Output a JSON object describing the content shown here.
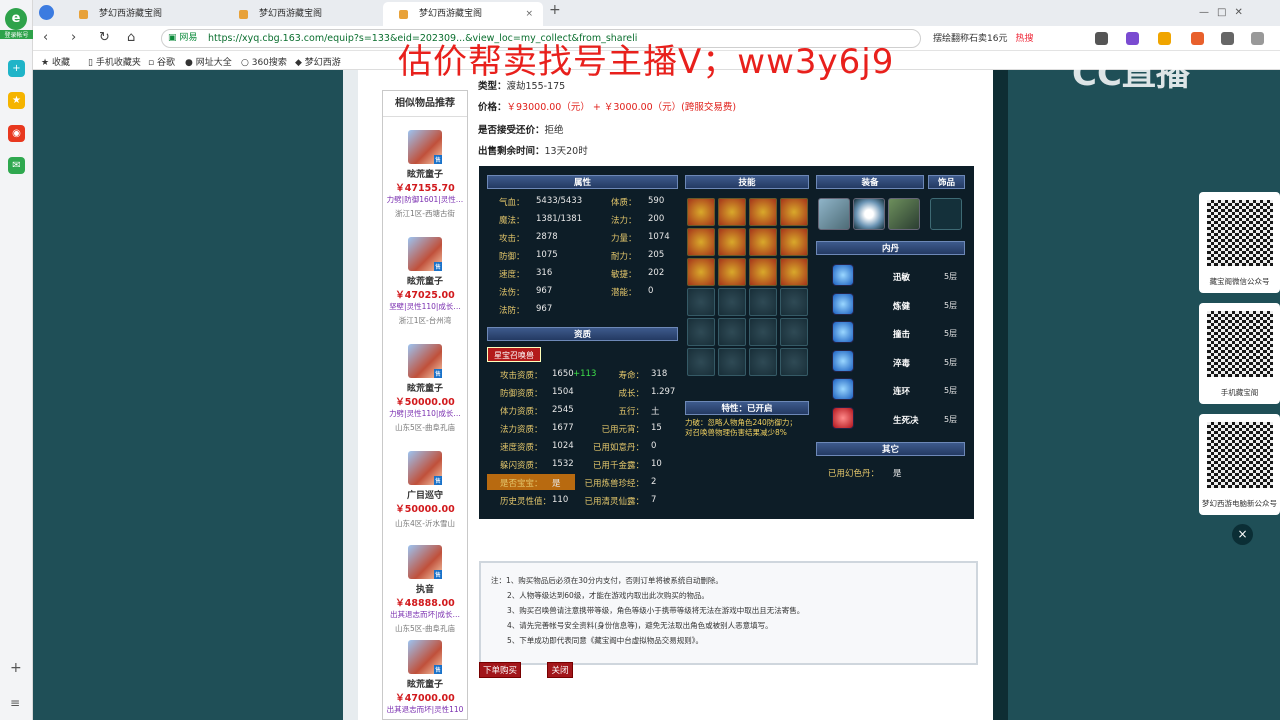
{
  "browser": {
    "left_badge": "登录帐号",
    "tabs": [
      {
        "title": "梦幻西游藏宝阁"
      },
      {
        "title": "梦幻西游藏宝阁"
      },
      {
        "title": "梦幻西游藏宝阁",
        "close": "×"
      }
    ],
    "newtab": "+",
    "address": "https://xyq.cbg.163.com/equip?s=133&eid=202309...&view_loc=my_collect&from_shareli",
    "address_label": "网易",
    "search_text": "摆绘翻称石卖16元",
    "hot_label": "热搜",
    "bookmarks": [
      "收藏",
      "手机收藏夹",
      "谷歌",
      "网址大全",
      "360搜索",
      "梦幻西游"
    ]
  },
  "overlay": {
    "watermark": "估价帮卖找号主播V；ww3y6j9",
    "logo": "CC直播"
  },
  "sidebar": {
    "title": "相似物品推荐",
    "items": [
      {
        "name": "眩荒童子",
        "price": "￥47155.70",
        "attrs": "力劈|防御1601|灵性…",
        "server": "浙江1区-西塘古街",
        "tag": "售"
      },
      {
        "name": "眩荒童子",
        "price": "￥47025.00",
        "attrs": "坚壁|灵性110|成长…",
        "server": "浙江1区-台州湾",
        "tag": "售"
      },
      {
        "name": "眩荒童子",
        "price": "￥50000.00",
        "attrs": "力劈|灵性110|成长…",
        "server": "山东5区-曲阜孔庙",
        "tag": "售"
      },
      {
        "name": "广目巡守",
        "price": "￥50000.00",
        "attrs": "",
        "server": "山东4区-沂水雪山",
        "tag": "售"
      },
      {
        "name": "执音",
        "price": "￥48888.00",
        "attrs": "出其退志而坏|成长…",
        "server": "山东5区-曲阜孔庙",
        "tag": "售"
      },
      {
        "name": "眩荒童子",
        "price": "￥47000.00",
        "attrs": "出其退志而坏|灵性110",
        "server": "",
        "tag": "售"
      }
    ]
  },
  "info": {
    "type_label": "类型：",
    "type_value": "渡劫155-175",
    "price_label": "价格：",
    "price_value": "￥93000.00（元）",
    "plus": "+",
    "fee": "￥3000.00（元）(跨服交易费)",
    "bargain_label": "是否接受还价：",
    "bargain_value": "拒绝",
    "time_label": "出售剩余时间：",
    "time_value": "13天20时"
  },
  "panel": {
    "headers": {
      "attrs": "属性",
      "skills": "技能",
      "equip": "装备",
      "deco": "饰品",
      "neidan": "内丹",
      "aptitude": "资质",
      "trait": "特性：已开启",
      "other": "其它"
    },
    "attrs": [
      {
        "label": "气血：",
        "value": "5433/5433",
        "label2": "体质：",
        "value2": "590"
      },
      {
        "label": "魔法：",
        "value": "1381/1381",
        "label2": "法力：",
        "value2": "200"
      },
      {
        "label": "攻击：",
        "value": "2878",
        "label2": "力量：",
        "value2": "1074"
      },
      {
        "label": "防御：",
        "value": "1075",
        "label2": "耐力：",
        "value2": "205"
      },
      {
        "label": "速度：",
        "value": "316",
        "label2": "敏捷：",
        "value2": "202"
      },
      {
        "label": "法伤：",
        "value": "967",
        "label2": "潜能：",
        "value2": "0"
      },
      {
        "label": "法防：",
        "value": "967",
        "label2": "",
        "value2": ""
      }
    ],
    "summon_btn": "星宝召唤兽",
    "aptitude": [
      {
        "label": "攻击资质：",
        "value": "1650",
        "bonus": "+113",
        "label2": "寿命：",
        "value2": "318"
      },
      {
        "label": "防御资质：",
        "value": "1504",
        "bonus": "",
        "label2": "成长：",
        "value2": "1.297"
      },
      {
        "label": "体力资质：",
        "value": "2545",
        "bonus": "",
        "label2": "五行：",
        "value2": "土"
      },
      {
        "label": "法力资质：",
        "value": "1677",
        "bonus": "",
        "label2": "已用元宵：",
        "value2": "15"
      },
      {
        "label": "速度资质：",
        "value": "1024",
        "bonus": "",
        "label2": "已用如意丹：",
        "value2": "0"
      },
      {
        "label": "躲闪资质：",
        "value": "1532",
        "bonus": "",
        "label2": "已用千金露：",
        "value2": "10"
      },
      {
        "label": "是否宝宝：",
        "value": "是",
        "bonus": "",
        "label2": "已用炼兽珍经：",
        "value2": "2"
      },
      {
        "label": "历史灵性值：",
        "value": "110",
        "bonus": "",
        "label2": "已用清灵仙露：",
        "value2": "7"
      }
    ],
    "trait_text_1": "力破：忽略人物角色240防御力；",
    "trait_text_2": "对召唤兽物理伤害结果减少8%",
    "neidan": [
      {
        "name": "迅敏",
        "level": "5层"
      },
      {
        "name": "炼健",
        "level": "5层"
      },
      {
        "name": "撞击",
        "level": "5层"
      },
      {
        "name": "淬毒",
        "level": "5层"
      },
      {
        "name": "连环",
        "level": "5层"
      },
      {
        "name": "生死决",
        "level": "5层"
      }
    ],
    "other_label": "已用幻色丹：",
    "other_value": "是"
  },
  "notes": {
    "lead": "注：",
    "lines": [
      "1、购买物品后必须在30分内支付，否则订单将被系统自动删除。",
      "2、人物等级达到60级，才能在游戏内取出此次购买的物品。",
      "3、购买召唤兽请注意携带等级，角色等级小于携带等级将无法在游戏中取出且无法寄售。",
      "4、请先完善帐号安全资料(身份信息等)，避免无法取出角色或被别人恶意填写。",
      "5、下单成功即代表同意《藏宝阁中台虚拟物品交易规则》。"
    ]
  },
  "actions": {
    "buy": "下单购买",
    "close": "关闭"
  },
  "right_panel": {
    "qr_captions": [
      "藏宝阁微信公众号",
      "手机藏宝阁",
      "梦幻西游电脑新公众号"
    ],
    "close": "×"
  }
}
